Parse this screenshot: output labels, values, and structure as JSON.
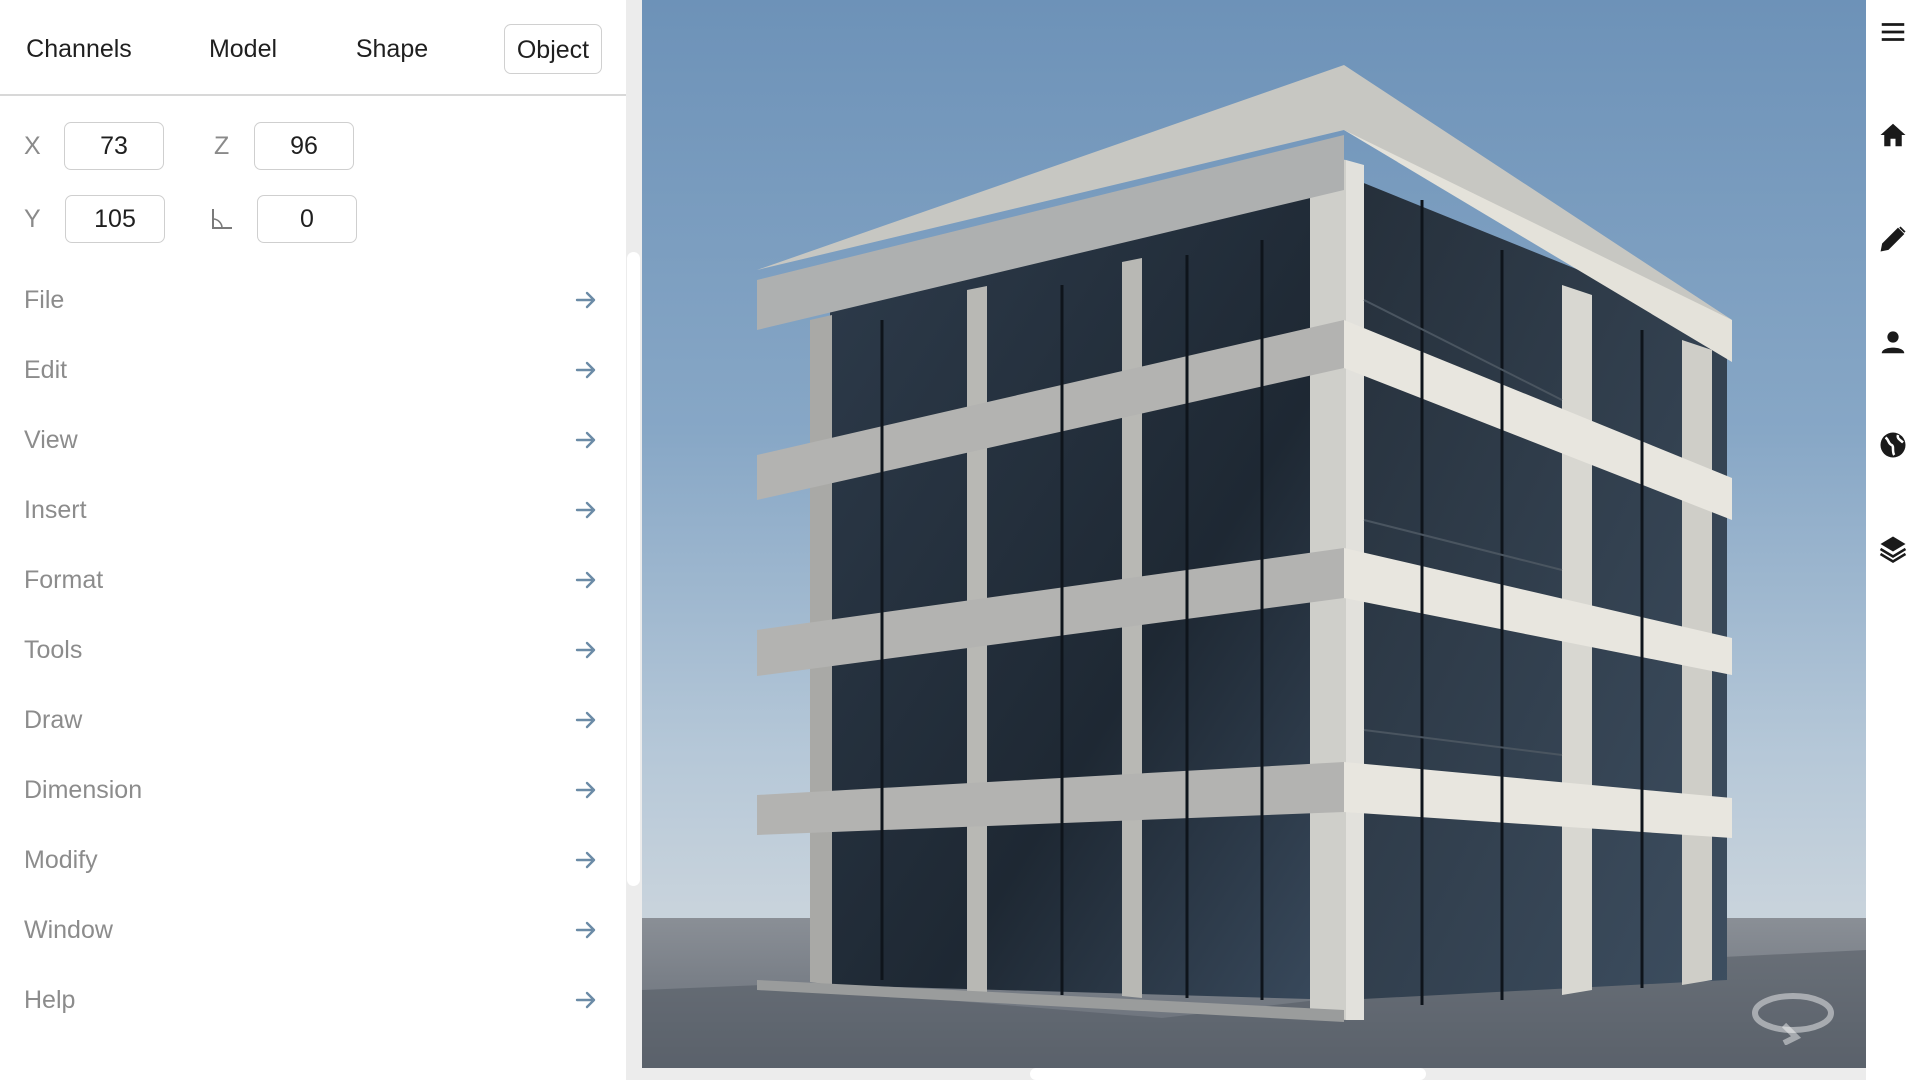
{
  "tabs": [
    {
      "label": "Channels",
      "active": false
    },
    {
      "label": "Model",
      "active": false
    },
    {
      "label": "Shape",
      "active": false
    },
    {
      "label": "Object",
      "active": true
    }
  ],
  "coords": {
    "x_label": "X",
    "x_value": "73",
    "z_label": "Z",
    "z_value": "96",
    "y_label": "Y",
    "y_value": "105",
    "angle_icon": "angle-icon",
    "angle_value": "0"
  },
  "menu": {
    "items": [
      {
        "label": "File"
      },
      {
        "label": "Edit"
      },
      {
        "label": "View"
      },
      {
        "label": "Insert"
      },
      {
        "label": "Format"
      },
      {
        "label": "Tools"
      },
      {
        "label": "Draw"
      },
      {
        "label": "Dimension"
      },
      {
        "label": "Modify"
      },
      {
        "label": "Window"
      },
      {
        "label": "Help"
      }
    ],
    "arrow_icon": "arrow-right-icon"
  },
  "toolbar": {
    "icons": [
      "hamburger-menu-icon",
      "home-icon",
      "pencil-icon",
      "person-icon",
      "globe-icon",
      "layers-icon"
    ]
  },
  "viewport": {
    "content": "3d-building-render",
    "orbit_icon": "orbit-icon"
  },
  "colors": {
    "accent_text": "#1f1f1f",
    "muted_text": "#8c8c8c",
    "arrow": "#6b8ba6",
    "sky_top": "#6d92b8"
  }
}
